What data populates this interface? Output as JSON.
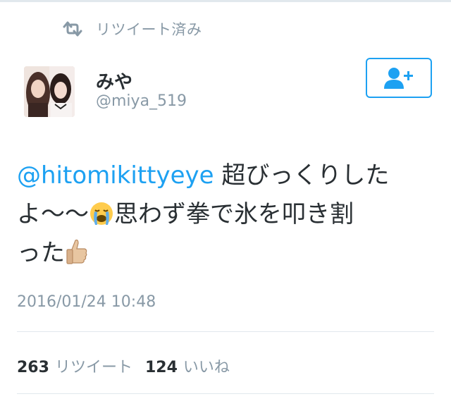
{
  "retweet_header": {
    "icon": "retweet-icon",
    "label": "リツイート済み"
  },
  "author": {
    "display_name": "みや",
    "handle": "@miya_519",
    "avatar": "profile-photo"
  },
  "follow_button": {
    "icon": "follow-user-plus-icon"
  },
  "tweet": {
    "mention": "@hitomikittyeye",
    "text_part1": " 超びっくりした",
    "text_part2": "よ～～",
    "emoji1": "loudly-crying-face-emoji",
    "text_part3": "思わず拳で氷を叩き割",
    "text_part4": "った",
    "emoji2": "thumbs-up-emoji"
  },
  "timestamp": "2016/01/24 10:48",
  "stats": {
    "retweets_count": "263",
    "retweets_label": "リツイート",
    "likes_count": "124",
    "likes_label": "いいね"
  },
  "colors": {
    "accent": "#1da1f2",
    "muted": "#8899a6",
    "text": "#292f33",
    "divider": "#e1e8ed"
  }
}
